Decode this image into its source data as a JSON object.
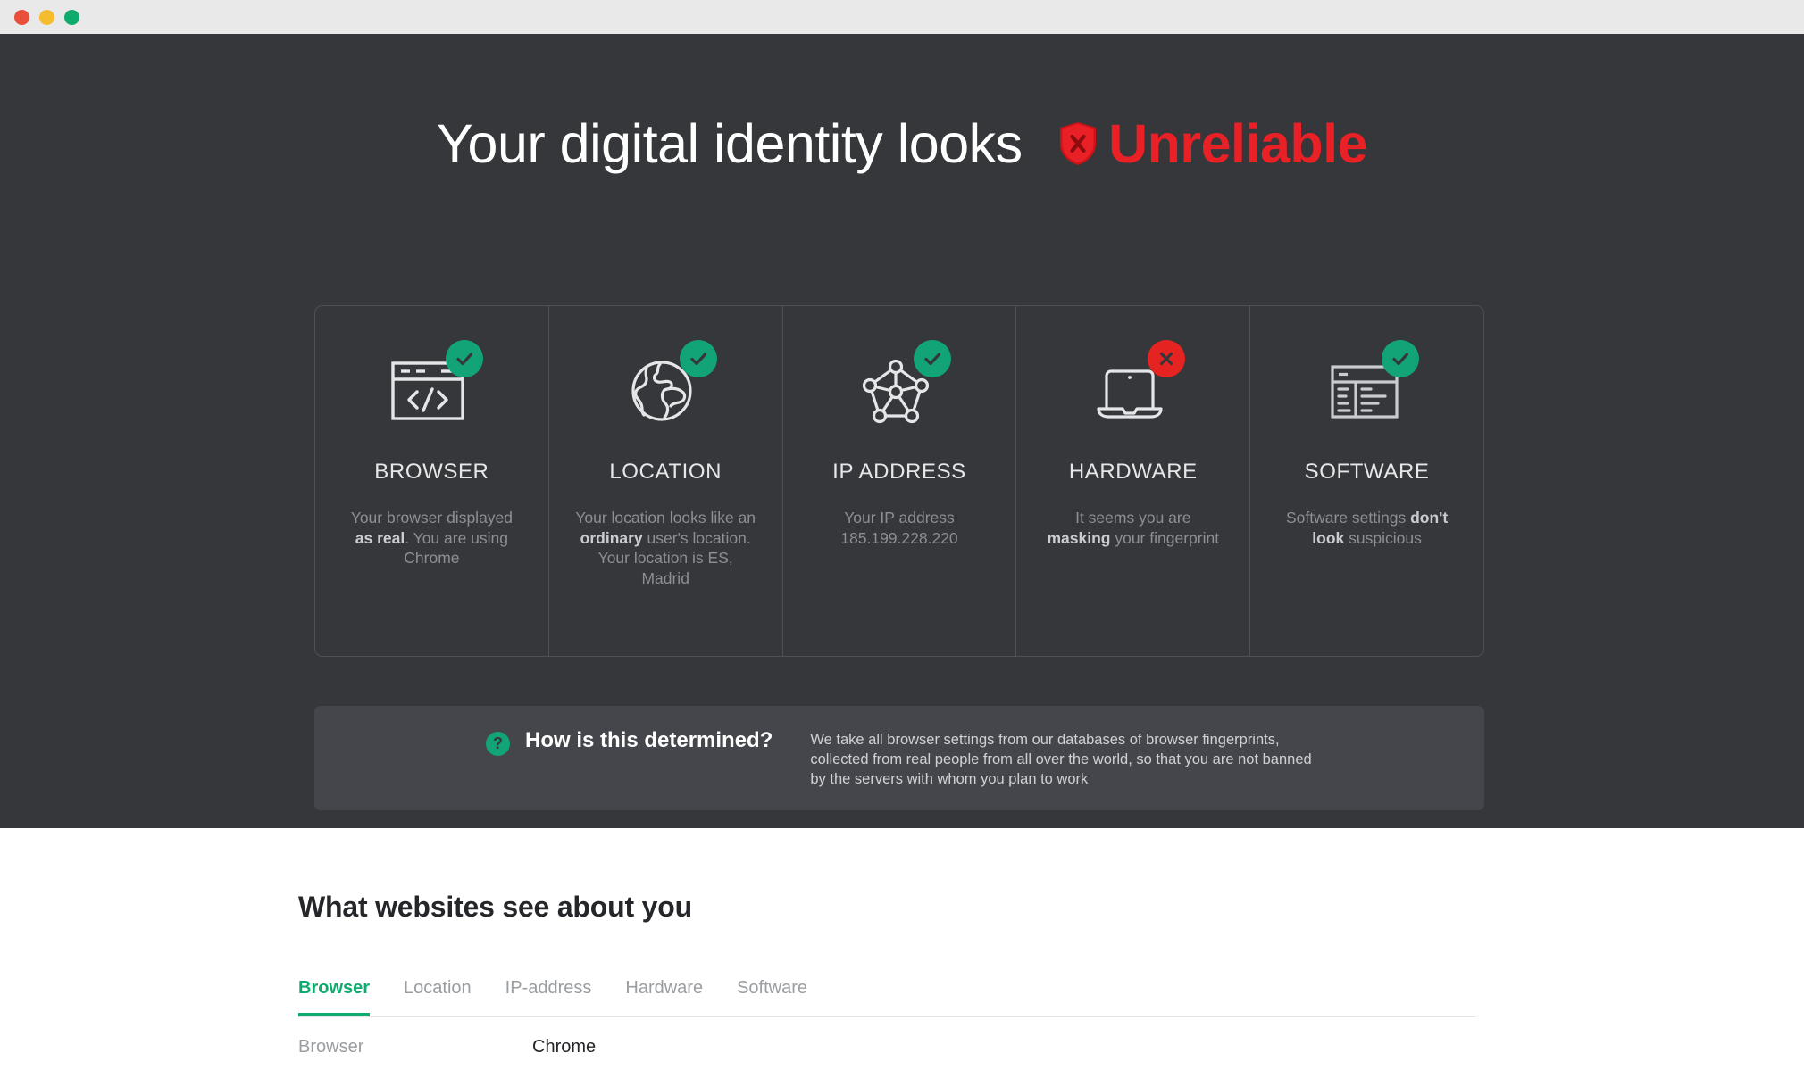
{
  "window": {
    "controls": [
      {
        "name": "close",
        "color": "#e8503a"
      },
      {
        "name": "minimize",
        "color": "#f5bc2e"
      },
      {
        "name": "maximize",
        "color": "#0fab6e"
      }
    ]
  },
  "hero": {
    "headline_prefix": "Your digital identity looks",
    "verdict": "Unreliable",
    "verdict_color": "#ea2027",
    "verdict_icon": "shield-x-icon"
  },
  "cards": [
    {
      "id": "browser",
      "title": "BROWSER",
      "icon": "browser-code-icon",
      "status": "ok",
      "status_icon": "check-icon",
      "desc_parts": [
        {
          "text": "Your browser displayed ",
          "bold": false
        },
        {
          "text": "as real",
          "bold": true
        },
        {
          "text": ". You are using Chrome",
          "bold": false
        }
      ]
    },
    {
      "id": "location",
      "title": "LOCATION",
      "icon": "globe-icon",
      "status": "ok",
      "status_icon": "check-icon",
      "desc_parts": [
        {
          "text": "Your location looks like an ",
          "bold": false
        },
        {
          "text": "ordinary",
          "bold": true
        },
        {
          "text": " user's location. Your location is ES, Madrid",
          "bold": false
        }
      ]
    },
    {
      "id": "ip-address",
      "title": "IP ADDRESS",
      "icon": "network-nodes-icon",
      "status": "ok",
      "status_icon": "check-icon",
      "desc_parts": [
        {
          "text": "Your IP address 185.199.228.220",
          "bold": false
        }
      ]
    },
    {
      "id": "hardware",
      "title": "HARDWARE",
      "icon": "laptop-icon",
      "status": "bad",
      "status_icon": "cross-icon",
      "desc_parts": [
        {
          "text": "It seems you are ",
          "bold": false
        },
        {
          "text": "masking",
          "bold": true
        },
        {
          "text": " your fingerprint",
          "bold": false
        }
      ]
    },
    {
      "id": "software",
      "title": "SOFTWARE",
      "icon": "software-window-icon",
      "status": "ok",
      "status_icon": "check-icon",
      "desc_parts": [
        {
          "text": "Software settings ",
          "bold": false
        },
        {
          "text": "don't look",
          "bold": true
        },
        {
          "text": " suspicious",
          "bold": false
        }
      ]
    }
  ],
  "info_bar": {
    "icon": "question-mark-icon",
    "title": "How is this determined?",
    "body": "We take all browser settings from our databases of browser fingerprints, collected from real people from all over the world, so that you are not banned by the servers with whom you plan to work"
  },
  "panel": {
    "title": "What websites see about you",
    "tabs": [
      {
        "label": "Browser",
        "active": true
      },
      {
        "label": "Location",
        "active": false
      },
      {
        "label": "IP-address",
        "active": false
      },
      {
        "label": "Hardware",
        "active": false
      },
      {
        "label": "Software",
        "active": false
      }
    ],
    "rows": [
      {
        "key": "Browser",
        "value": "Chrome"
      }
    ]
  },
  "colors": {
    "hero_bg": "#35373b",
    "card_border": "#4e5055",
    "info_bar_bg": "#45464b",
    "accent_green": "#0fab6e",
    "status_ok": "#12a477",
    "status_bad": "#e52421",
    "danger_red": "#ea2027"
  }
}
